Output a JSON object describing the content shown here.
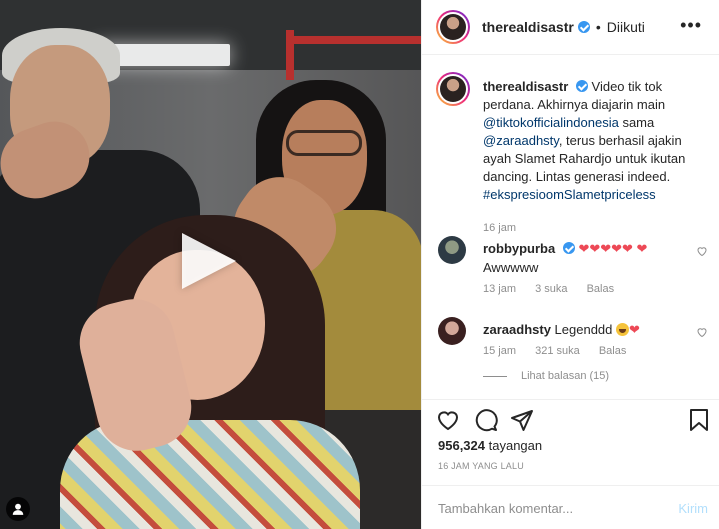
{
  "header": {
    "username": "therealdisastr",
    "separator": "•",
    "follow_status": "Diikuti",
    "more_icon": "more-dots-icon"
  },
  "caption": {
    "username": "therealdisastr",
    "text_1": "Video tik tok perdana. Akhirnya diajarin main",
    "mention_1": "@tiktokofficialindonesia",
    "text_2": "sama",
    "mention_2": "@zaraadhsty",
    "text_3": ", terus berhasil ajakin ayah Slamet Rahardjo untuk ikutan dancing. Lintas generasi indeed.",
    "hashtag": "#ekspresioomSlametpriceless",
    "time": "16 jam"
  },
  "comments": [
    {
      "username": "robbypurba",
      "text": "Awwwww",
      "time": "13 jam",
      "likes": "3 suka",
      "reply": "Balas"
    },
    {
      "username": "zaraadhsty",
      "text": "Legenddd",
      "time": "15 jam",
      "likes": "321 suka",
      "reply": "Balas"
    }
  ],
  "view_replies": "Lihat balasan (15)",
  "stats": {
    "views": "956,324",
    "views_label": "tayangan",
    "ago": "16 JAM YANG LALU"
  },
  "add_comment": {
    "placeholder": "Tambahkan komentar...",
    "send_label": "Kirim"
  },
  "colors": {
    "link": "#00376b",
    "verified": "#3897f0",
    "heart": "#ed4956",
    "muted": "#8e8e8e"
  }
}
